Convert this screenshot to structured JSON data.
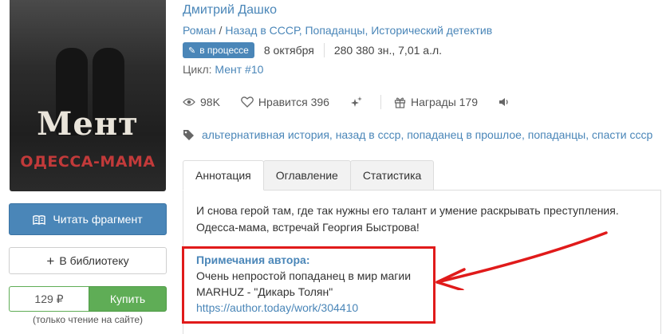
{
  "cover": {
    "title": "Мент",
    "subtitle": "ОДЕССА-МАМА"
  },
  "actions": {
    "read_fragment": "Читать фрагмент",
    "add_library": "В библиотеку",
    "price": "129 ₽",
    "buy": "Купить",
    "read_note": "(только чтение на сайте)"
  },
  "book": {
    "author": "Дмитрий Дашко",
    "genres": [
      "Роман",
      "Назад в СССР",
      "Попаданцы",
      "Исторический детектив"
    ],
    "genre_sep": "/",
    "status": "в процессе",
    "date": "8 октября",
    "size": "280 380 зн., 7,01 а.л.",
    "cycle_label": "Цикл:",
    "cycle_value": "Мент #10"
  },
  "stats": {
    "views": "98K",
    "likes": "Нравится 396",
    "awards": "Награды 179"
  },
  "tags": [
    "альтернативная история",
    "назад в ссср",
    "попаданец в прошлое",
    "попаданцы",
    "спасти ссср"
  ],
  "tabs": [
    "Аннотация",
    "Оглавление",
    "Статистика"
  ],
  "annotation": {
    "line1": "И снова герой там, где так нужны его талант и умение раскрывать преступления.",
    "line2": "Одесса-мама, встречай Георгия Быстрова!"
  },
  "author_notes": {
    "heading": "Примечания автора:",
    "line1": "Очень непростой попаданец в мир магии",
    "line2": "MARHUZ - \"Дикарь Толян\"",
    "link": "https://author.today/work/304410"
  },
  "colors": {
    "accent": "#4a86b8",
    "buy": "#5fad56",
    "highlight": "#e01a1a"
  }
}
